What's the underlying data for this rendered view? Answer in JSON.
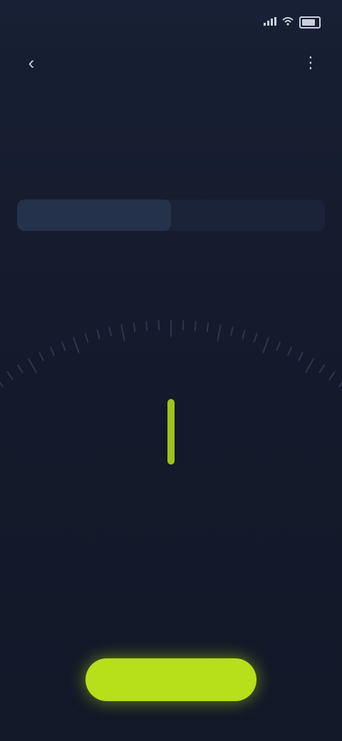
{
  "status_bar": {
    "time": "",
    "signal_icon": "signal-icon",
    "wifi_icon": "wifi-icon",
    "battery_icon": "battery-icon"
  },
  "header": {
    "title": "",
    "back_icon": "chevron-left-icon",
    "menu_icon": "more-icon"
  },
  "intro": {
    "title": "",
    "description": ""
  },
  "tabs": [
    {
      "label": "",
      "active": true
    },
    {
      "label": "",
      "active": false
    }
  ],
  "dial": {
    "value": "",
    "unit": "",
    "indicator_color": "#b6e01a",
    "tick_color": "#2b3650"
  },
  "primary_button": {
    "label": ""
  },
  "colors": {
    "background": "#131a2b",
    "accent": "#b6e01a",
    "text_muted": "#8793a8"
  }
}
